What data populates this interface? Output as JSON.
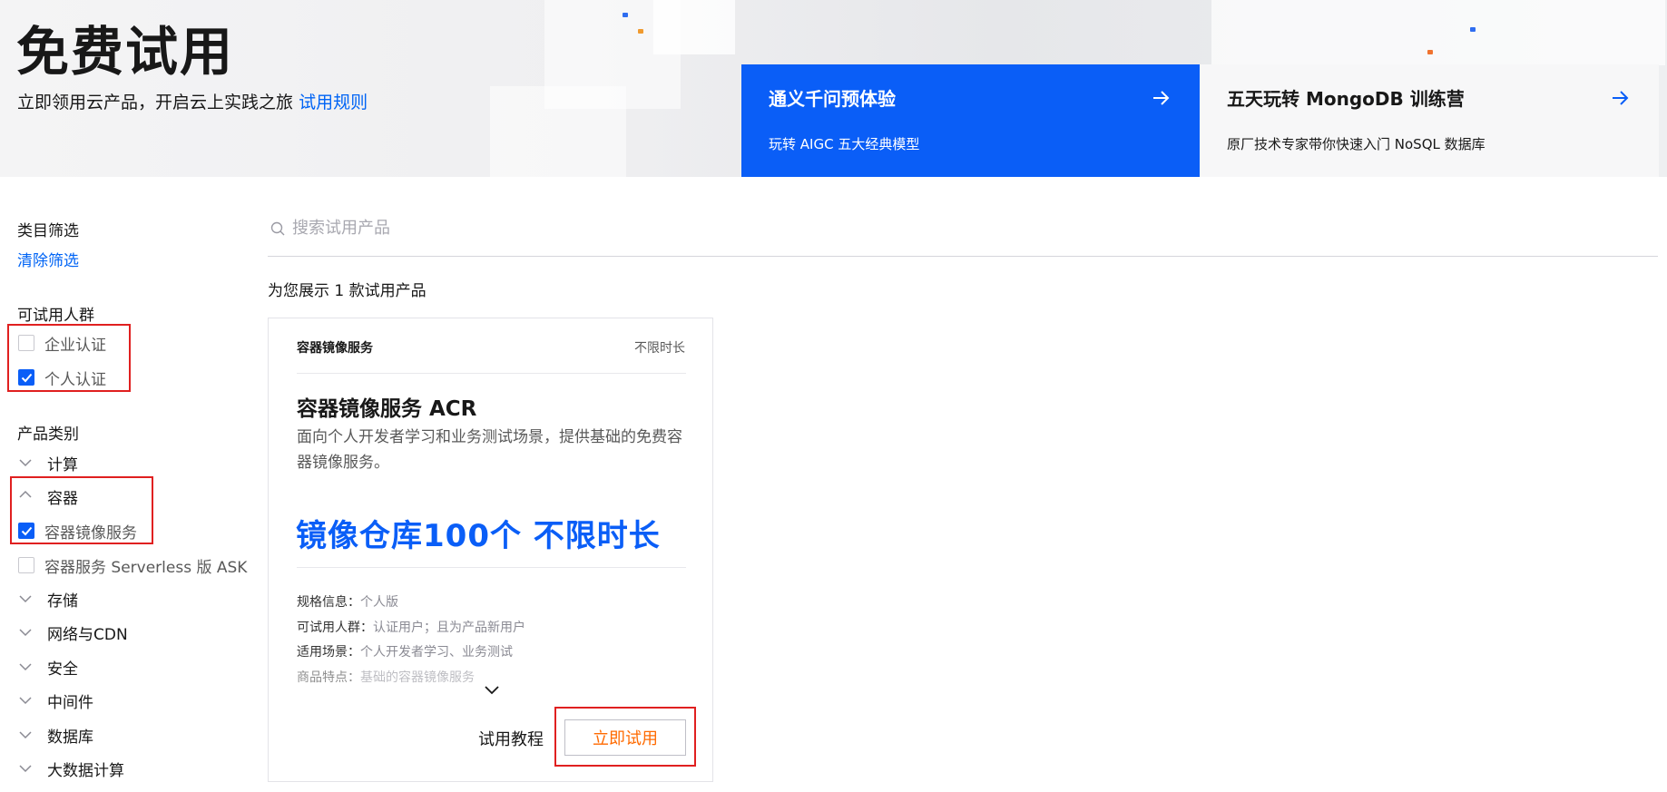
{
  "header": {
    "title": "免费试用",
    "subtitle": "立即领用云产品，开启云上实践之旅",
    "rules_link": "试用规则"
  },
  "promos": [
    {
      "title": "通义千问预体验",
      "desc": "玩转 AIGC 五大经典模型",
      "icon": "arrow-right-icon",
      "bg": "#0a5ef7"
    },
    {
      "title": "五天玩转 MongoDB 训练营",
      "desc": "原厂技术专家带你快速入门 NoSQL 数据库",
      "icon": "arrow-right-icon",
      "bg": "#f7f7f8"
    }
  ],
  "sidebar": {
    "filter_title": "类目筛选",
    "clear_filter": "清除筛选",
    "audience": {
      "title": "可试用人群",
      "options": [
        {
          "label": "企业认证",
          "checked": false
        },
        {
          "label": "个人认证",
          "checked": true
        }
      ]
    },
    "product_category": {
      "title": "产品类别",
      "categories": [
        {
          "label": "计算",
          "expanded": false
        },
        {
          "label": "容器",
          "expanded": true
        },
        {
          "label": "存储",
          "expanded": false
        },
        {
          "label": "网络与CDN",
          "expanded": false
        },
        {
          "label": "安全",
          "expanded": false
        },
        {
          "label": "中间件",
          "expanded": false
        },
        {
          "label": "数据库",
          "expanded": false
        },
        {
          "label": "大数据计算",
          "expanded": false
        }
      ],
      "container_items": [
        {
          "label": "容器镜像服务",
          "checked": true
        },
        {
          "label": "容器服务 Serverless 版 ASK",
          "checked": false
        }
      ]
    }
  },
  "search": {
    "placeholder": "搜索试用产品",
    "value": ""
  },
  "results": {
    "count_text": "为您展示 1 款试用产品"
  },
  "card": {
    "product_name": "容器镜像服务",
    "duration_badge": "不限时长",
    "title": "容器镜像服务 ACR",
    "description": "面向个人开发者学习和业务测试场景，提供基础的免费容器镜像服务。",
    "highlight": "镜像仓库100个 不限时长",
    "specs": [
      {
        "key": "规格信息：",
        "value": "个人版"
      },
      {
        "key": "可试用人群：",
        "value": "认证用户；且为产品新用户"
      },
      {
        "key": "适用场景：",
        "value": "个人开发者学习、业务测试"
      },
      {
        "key": "商品特点：",
        "value": "基础的容器镜像服务"
      }
    ],
    "tutorial_label": "试用教程",
    "try_label": "立即试用"
  },
  "colors": {
    "accent": "#0a5ef7",
    "link": "#0064f5",
    "cta": "#ff6a00",
    "annotation": "#e02020"
  }
}
